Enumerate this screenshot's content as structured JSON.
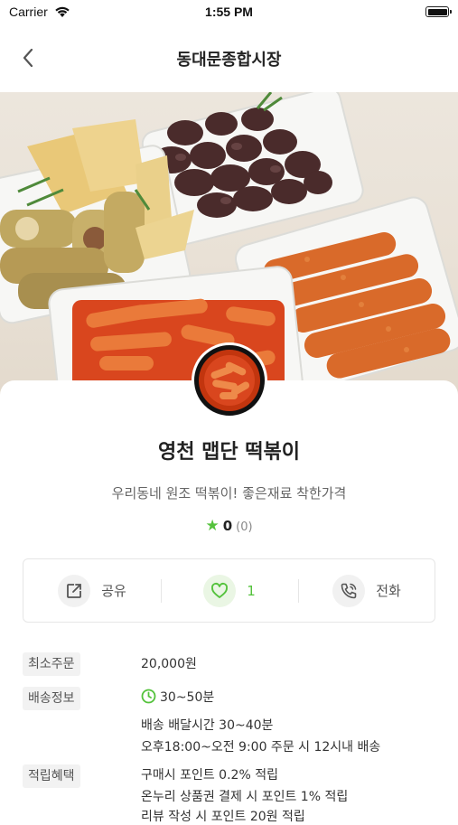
{
  "status_bar": {
    "carrier": "Carrier",
    "time": "1:55 PM"
  },
  "nav": {
    "title": "동대문종합시장"
  },
  "store": {
    "name": "영천 맵단 떡볶이",
    "tagline": "우리동네 원조 떡볶이! 좋은재료 착한가격",
    "rating": "0",
    "review_count": "(0)"
  },
  "actions": {
    "share_label": "공유",
    "like_count": "1",
    "call_label": "전화"
  },
  "info": {
    "min_order_label": "최소주문",
    "min_order_value": "20,000원",
    "delivery_label": "배송정보",
    "delivery_time": "30~50분",
    "delivery_line1": "배송  배달시간 30~40분",
    "delivery_line2": "오후18:00~오전 9:00 주문 시 12시내 배송",
    "benefit_label": "적립혜택",
    "benefit_line1": "구매시 포인트 0.2% 적립",
    "benefit_line2": "온누리 상품권 결제 시 포인트 1% 적립",
    "benefit_line3": "리뷰 작성 시 포인트 20원 적립"
  },
  "colors": {
    "accent": "#54c23c",
    "tag_bg": "#f2f2f2",
    "border": "#e6e6e6"
  },
  "icons": [
    "wifi-icon",
    "battery-icon",
    "back-icon",
    "share-icon",
    "heart-icon",
    "phone-icon",
    "star-icon",
    "clock-icon"
  ]
}
